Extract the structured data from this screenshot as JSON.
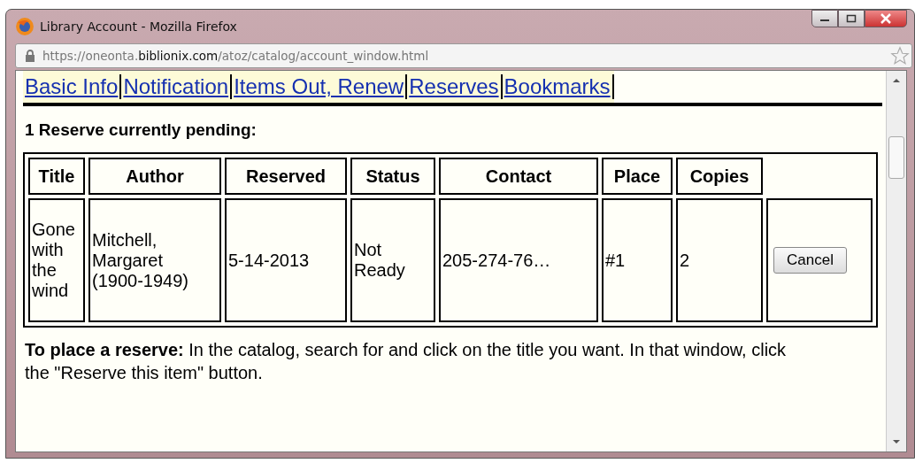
{
  "window": {
    "title": "Library Account - Mozilla Firefox"
  },
  "address_bar": {
    "url": "https://oneonta.**biblionix.com**/atoz/catalog/account_window.html"
  },
  "tabs": [
    {
      "label": "Basic Info"
    },
    {
      "label": "Notification"
    },
    {
      "label": "Items Out, Renew"
    },
    {
      "label": "Reserves"
    },
    {
      "label": "Bookmarks"
    }
  ],
  "heading": "1 Reserve currently pending:",
  "table": {
    "columns": [
      "Title",
      "Author",
      "Reserved",
      "Status",
      "Contact",
      "Place",
      "Copies"
    ],
    "rows": [
      {
        "cells": [
          "Gone with the wind",
          "Mitchell, Margaret (1900-1949)",
          "5-14-2013",
          "Not Ready",
          "205-274-76…",
          "#1",
          "2"
        ],
        "action": "Cancel"
      }
    ]
  },
  "note": "**To place a reserve:** In the catalog, search for and click on the title you want. In that window, click the \"Reserve this item\" button."
}
